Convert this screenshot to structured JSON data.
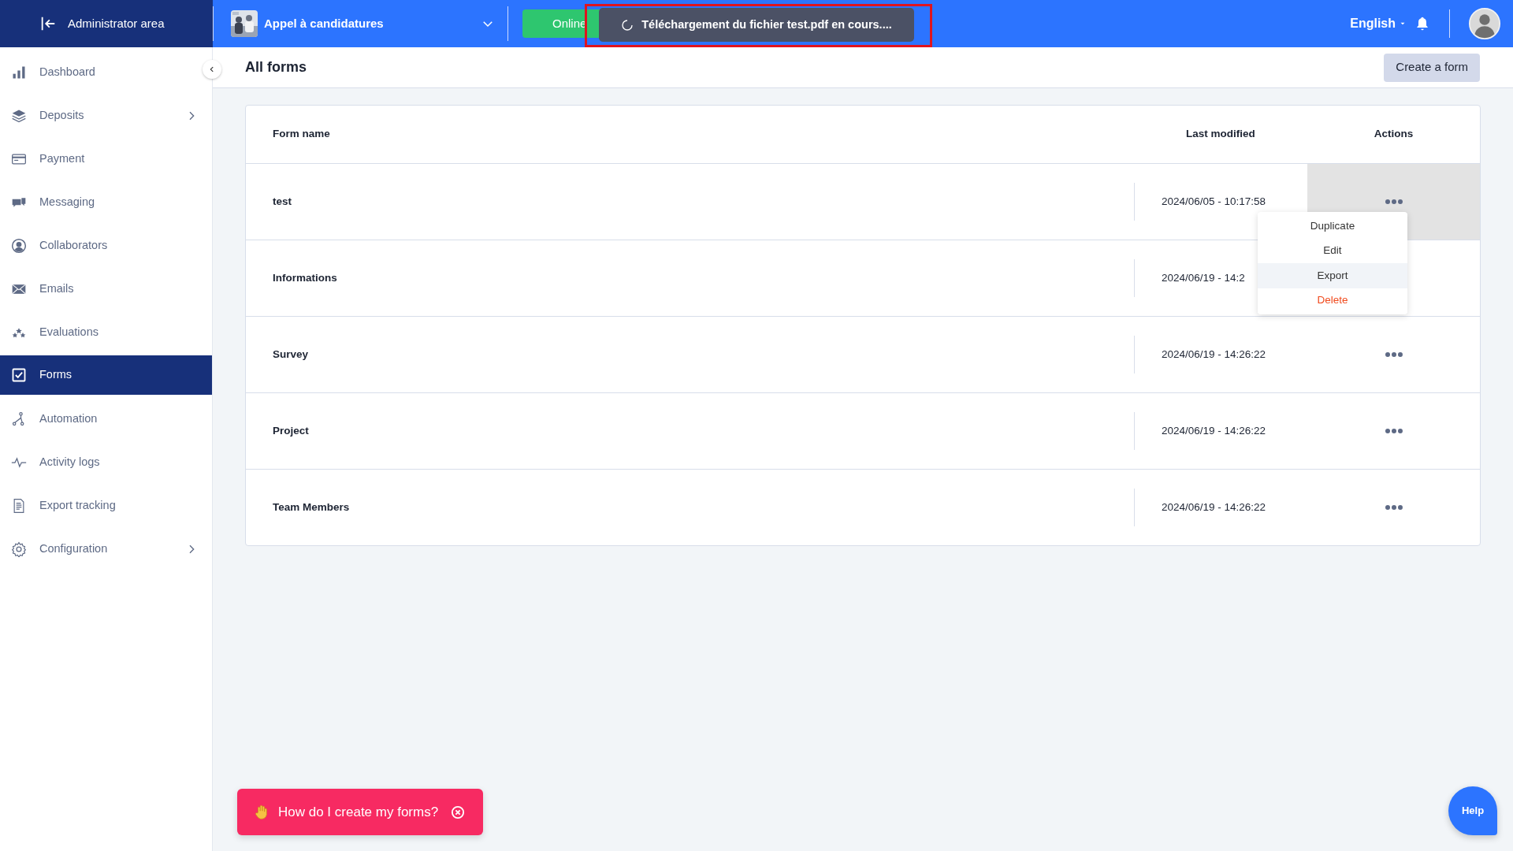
{
  "header": {
    "section_link": "Administrator area",
    "project": "Appel à candidatures",
    "status_button": "Online",
    "toast": "Téléchargement du fichier test.pdf en cours....",
    "language": "English"
  },
  "sidebar": {
    "items": [
      {
        "label": "Dashboard",
        "selected": false,
        "expandable": false
      },
      {
        "label": "Deposits",
        "selected": false,
        "expandable": true
      },
      {
        "label": "Payment",
        "selected": false,
        "expandable": false
      },
      {
        "label": "Messaging",
        "selected": false,
        "expandable": false
      },
      {
        "label": "Collaborators",
        "selected": false,
        "expandable": false
      },
      {
        "label": "Emails",
        "selected": false,
        "expandable": false
      },
      {
        "label": "Evaluations",
        "selected": false,
        "expandable": false
      },
      {
        "label": "Forms",
        "selected": true,
        "expandable": false
      },
      {
        "label": "Automation",
        "selected": false,
        "expandable": false
      },
      {
        "label": "Activity logs",
        "selected": false,
        "expandable": false
      },
      {
        "label": "Export tracking",
        "selected": false,
        "expandable": false
      },
      {
        "label": "Configuration",
        "selected": false,
        "expandable": true
      }
    ]
  },
  "page": {
    "title": "All forms",
    "create_button": "Create a form"
  },
  "table": {
    "columns": [
      "Form name",
      "Last modified",
      "Actions"
    ],
    "rows": [
      {
        "name": "test",
        "modified": "2024/06/05 - 10:17:58",
        "menu_open": true
      },
      {
        "name": "Informations",
        "modified": "2024/06/19 - 14:2",
        "menu_open": false
      },
      {
        "name": "Survey",
        "modified": "2024/06/19 - 14:26:22",
        "menu_open": false
      },
      {
        "name": "Project",
        "modified": "2024/06/19 - 14:26:22",
        "menu_open": false
      },
      {
        "name": "Team Members",
        "modified": "2024/06/19 - 14:26:22",
        "menu_open": false
      }
    ],
    "action_menu": [
      {
        "label": "Duplicate",
        "kind": "normal",
        "selected": false
      },
      {
        "label": "Edit",
        "kind": "normal",
        "selected": false
      },
      {
        "label": "Export",
        "kind": "normal",
        "selected": true
      },
      {
        "label": "Delete",
        "kind": "danger",
        "selected": false
      }
    ]
  },
  "help_prompt": "How do I create my forms?",
  "help_button": "Help"
}
